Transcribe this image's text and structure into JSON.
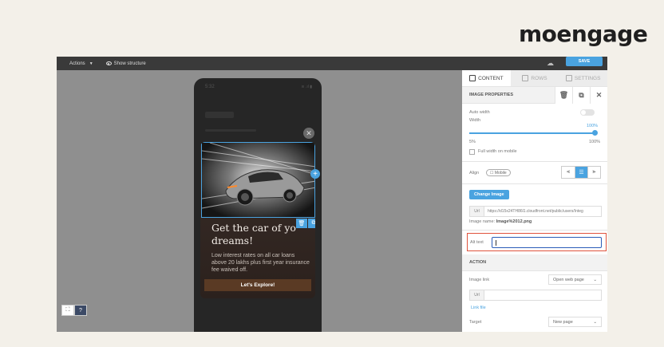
{
  "brand": {
    "logo_text": "moengage"
  },
  "topbar": {
    "actions_label": "Actions",
    "show_structure_label": "Show structure",
    "save_label": "SAVE"
  },
  "phone": {
    "status_time": "5:32",
    "status_icons": "≋ .ıl ▮",
    "card_title": "Get the car of yo\ndreams!",
    "card_body": "Low interest rates on all car loans above 20 lakhs plus first year insurance fee waived off.",
    "cta_label": "Let's Explore!"
  },
  "panel": {
    "tabs": [
      {
        "label": "CONTENT",
        "icon": "grid-icon",
        "active": true
      },
      {
        "label": "ROWS",
        "icon": "rows-icon",
        "active": false
      },
      {
        "label": "SETTINGS",
        "icon": "settings-icon",
        "active": false
      }
    ],
    "image_properties_title": "IMAGE PROPERTIES",
    "auto_width_label": "Auto width",
    "width_label": "Width",
    "width_value": "100%",
    "width_percent": 100,
    "min_label": "5%",
    "max_label": "100%",
    "full_width_mobile_label": "Full width on mobile",
    "align_label": "Align",
    "mobile_pill": "☐ Mobile",
    "change_image_label": "Change Image",
    "url_label": "Url",
    "url_value": "https://d15x24TH86l1.cloudfront.net/public/users/Integ",
    "image_name_label": "Image name:",
    "image_name_value": "Image%2012.png",
    "alt_text_label": "Alt text",
    "action_title": "ACTION",
    "image_link_label": "Image link",
    "image_link_value": "Open web page",
    "link_url_label": "Url",
    "link_file_label": "Link file",
    "target_label": "Target",
    "target_value": "New page"
  }
}
